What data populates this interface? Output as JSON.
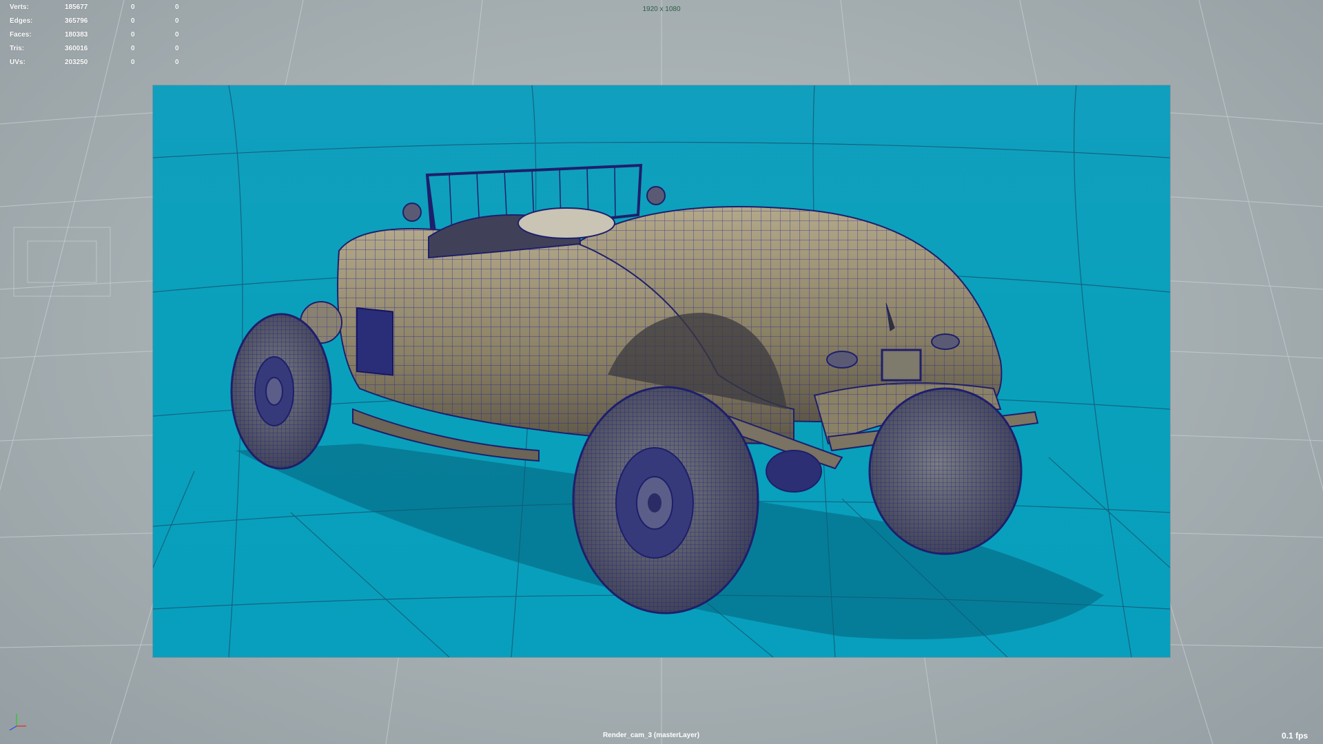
{
  "hud": {
    "stats": [
      {
        "label": "Verts:",
        "total": "185677",
        "selected": "0",
        "components": "0"
      },
      {
        "label": "Edges:",
        "total": "365796",
        "selected": "0",
        "components": "0"
      },
      {
        "label": "Faces:",
        "total": "180383",
        "selected": "0",
        "components": "0"
      },
      {
        "label": "Tris:",
        "total": "360016",
        "selected": "0",
        "components": "0"
      },
      {
        "label": "UVs:",
        "total": "203250",
        "selected": "0",
        "components": "0"
      }
    ],
    "resolution": "1920 x 1080",
    "camera": "Render_cam_3 (masterLayer)",
    "fps": "0.1 fps"
  },
  "colors": {
    "viewport_background": "#a9b2b5",
    "render_background": "#0aa0bc",
    "wireframe": "#1a1a9e",
    "car_body": "#8d8466",
    "hud_text": "#ffffff"
  },
  "icons": {
    "axis": "axis-gizmo-icon"
  }
}
